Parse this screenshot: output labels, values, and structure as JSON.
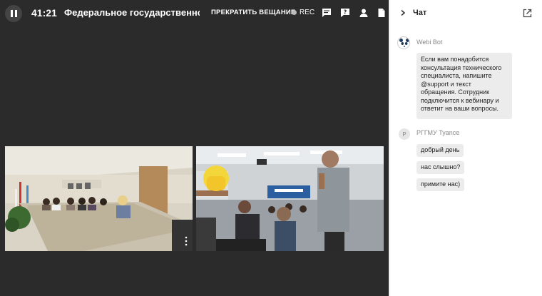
{
  "toolbar": {
    "timer": "41:21",
    "title": "Федеральное государственное",
    "stop_broadcast": "ПРЕКРАТИТЬ ВЕЩАНИЕ",
    "rec": "REC"
  },
  "chat": {
    "title": "Чат",
    "messages": [
      {
        "author": "Webi Bot",
        "text": "Если вам понадобится консультация технического специалиста, напишите @support и текст обращения. Сотрудник подключится к вебинару и ответит на ваши вопросы."
      },
      {
        "author": "РГГМУ Tyance",
        "avatar_letter": "Р",
        "lines": [
          "добрый день",
          "нас слышно?",
          "примите нас)"
        ]
      }
    ]
  },
  "videos": [
    {
      "label": ""
    },
    {
      "label": ""
    }
  ],
  "colors": {
    "stage_bg": "#2b2b2b",
    "chat_bg": "#ffffff",
    "bubble": "#ececec"
  }
}
